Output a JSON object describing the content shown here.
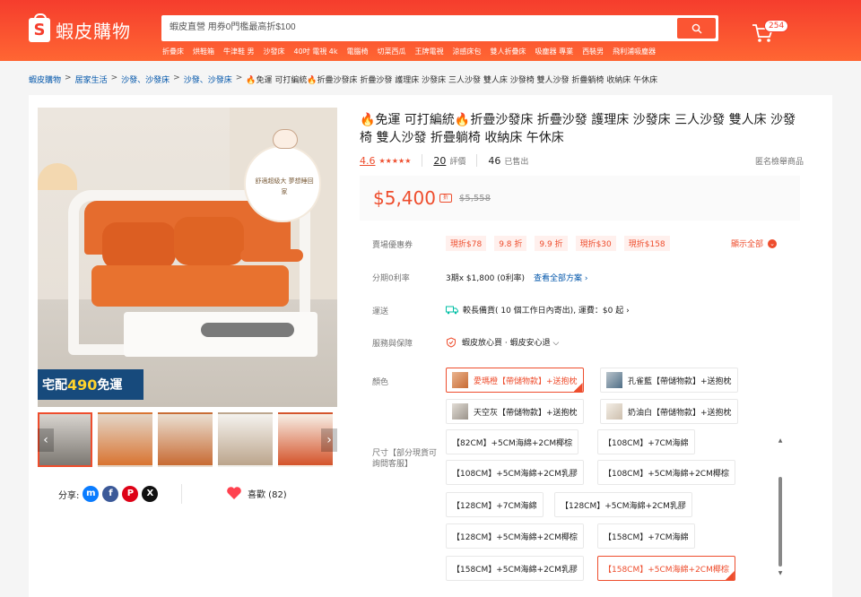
{
  "header": {
    "brand": "蝦皮購物",
    "logo_letter": "S",
    "search_value": "蝦皮直營 用券0門檻最高折$100",
    "hotwords": [
      "折疊床",
      "烘鞋箱",
      "牛津鞋 男",
      "沙發床",
      "40吋 電視 4k",
      "電腦椅",
      "切菜西瓜",
      "王牌電視",
      "涼感床包",
      "雙人折疊床",
      "吸塵器 專業",
      "西裝男",
      "飛利浦吸塵器"
    ],
    "cart_count": "254"
  },
  "breadcrumb": [
    "蝦皮購物",
    "居家生活",
    "沙發、沙發床",
    "沙發、沙發床"
  ],
  "breadcrumb_current": "🔥免運 可打編統🔥折疊沙發床 折疊沙發 護理床 沙發床 三人沙發 雙人床 沙發椅 雙人沙發 折疊躺椅 收納床 午休床",
  "gallery": {
    "promo_prefix": "宅配",
    "promo_num": "490",
    "promo_suffix": "免運",
    "cloud_text": "舒適超級大 夢想睡回家"
  },
  "social": {
    "share_label": "分享:",
    "likes": "喜歡 (82)"
  },
  "product": {
    "title": "🔥免運 可打編統🔥折疊沙發床 折疊沙發 護理床 沙發床 三人沙發 雙人床 沙發椅 雙人沙發 折疊躺椅 收納床 午休床",
    "rating": "4.6",
    "stars": "★★★★★",
    "reviews": "20",
    "reviews_label": "評價",
    "sold": "46",
    "sold_label": "已售出",
    "report": "匿名檢舉商品",
    "price": "$5,400",
    "discount_tag": "折",
    "old_price": "$5,558"
  },
  "rows": {
    "voucher_label": "賣場優惠券",
    "vouchers": [
      "現折$78",
      "9.8 折",
      "9.9 折",
      "現折$30",
      "現折$158"
    ],
    "show_all": "顯示全部",
    "installment_label": "分期0利率",
    "installment_value": "3期x $1,800 (0利率)",
    "installment_link": "查看全部方案 ›",
    "shipping_label": "運送",
    "shipping_value": "較長備貨( 10 個工作日內寄出), 運費：$0 起 ›",
    "guarantee_label": "服務與保障",
    "guarantee_value": "蝦皮放心買 · 蝦皮安心退 ⌵",
    "color_label": "顏色",
    "colors": [
      "愛瑪橙【帶儲物款】+送抱枕",
      "孔雀藍【帶儲物款】+送抱枕",
      "天空灰【帶儲物款】+送抱枕",
      "奶油白【帶儲物款】+送抱枕"
    ],
    "size_label": "尺寸【部分現貨可詢問客服】",
    "sizes": [
      "【82CM】+5CM海綿+2CM椰棕",
      "【108CM】+7CM海綿",
      "【108CM】+5CM海綿+2CM乳膠",
      "【108CM】+5CM海綿+2CM椰棕",
      "【128CM】+7CM海綿",
      "【128CM】+5CM海綿+2CM乳膠",
      "【128CM】+5CM海綿+2CM椰棕",
      "【158CM】+7CM海綿",
      "【158CM】+5CM海綿+2CM乳膠",
      "【158CM】+5CM海綿+2CM椰棕"
    ]
  },
  "colors": {
    "brand": "#ee4d2d",
    "link": "#0055aa"
  }
}
